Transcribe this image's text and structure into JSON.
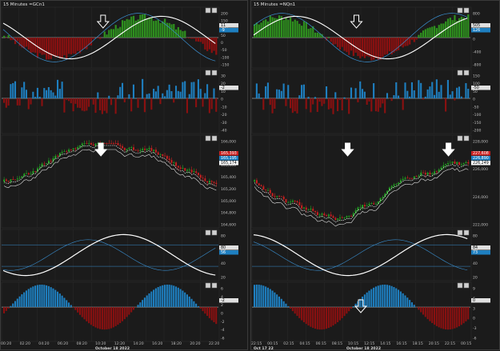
{
  "colors": {
    "bg": "#1b1b1b",
    "grid": "#2e2e2e",
    "green_bar": "#2e8f1e",
    "red_bar": "#8b1010",
    "blue_bar": "#1e7fc0",
    "candle_up": "#22a322",
    "candle_down": "#c92020",
    "white_line": "#ffffff",
    "blue_line": "#3a8fd0",
    "arrow": "#ffffff"
  },
  "charts": [
    {
      "id": "left",
      "title": "15 Minutes =GCn1",
      "panes": [
        {
          "ticks": [
            "200",
            "150",
            "100",
            "50",
            "0",
            "-50",
            "-100",
            "-150"
          ],
          "badges": [
            "11",
            "-9"
          ]
        },
        {
          "ticks": [
            "30",
            "20",
            "10",
            "0",
            "-10",
            "-20",
            "-30",
            "-40"
          ],
          "badges": [
            "-2"
          ]
        },
        {
          "ticks": [
            "166,000",
            "165,800",
            "165,600",
            "165,400",
            "165,200",
            "165,000",
            "164,800",
            "164,600"
          ],
          "badges": [
            "165,393",
            "165,195",
            "165,174"
          ]
        },
        {
          "ticks": [
            "80",
            "60",
            "40",
            "20"
          ],
          "badges": [
            "80",
            "56"
          ]
        },
        {
          "ticks": [
            "6",
            "4",
            "2",
            "0",
            "-2",
            "-4",
            "-6"
          ],
          "badges": [
            "-2"
          ]
        }
      ],
      "xlabels": [
        "00:20",
        "02:20",
        "04:20",
        "06:20",
        "08:20",
        "10:20",
        "12:20",
        "14:20",
        "16:20",
        "18:20",
        "20:20",
        "22:20"
      ],
      "xcenter": "October 18 2022",
      "arrows": [
        {
          "pane": 0,
          "style": "outline"
        },
        {
          "pane": 2,
          "style": "solid"
        }
      ]
    },
    {
      "id": "right",
      "title": "15 Minutes =NQn1",
      "panes": [
        {
          "ticks": [
            "800",
            "400",
            "0",
            "-400",
            "-800"
          ],
          "badges": [
            "505",
            "126"
          ]
        },
        {
          "ticks": [
            "150",
            "100",
            "50",
            "0",
            "-50",
            "-100",
            "-150",
            "-200"
          ],
          "badges": [
            "-50"
          ]
        },
        {
          "ticks": [
            "228,000",
            "226,000",
            "224,000",
            "222,000"
          ],
          "badges": [
            "227,608",
            "226,890",
            "226,249"
          ]
        },
        {
          "ticks": [
            "80",
            "60",
            "40",
            "20"
          ],
          "badges": [
            "84",
            "73"
          ]
        },
        {
          "ticks": [
            "9",
            "6",
            "3",
            "0",
            "-3",
            "-6"
          ],
          "badges": [
            "0"
          ]
        }
      ],
      "xlabels": [
        "22:15",
        "00:15",
        "02:15",
        "04:15",
        "06:15",
        "08:15",
        "10:15",
        "12:15",
        "14:15",
        "16:15",
        "18:15",
        "20:15",
        "22:15",
        "00:15"
      ],
      "xleft": "Oct 17 22",
      "xcenter": "October 18 2022",
      "arrows": [
        {
          "pane": 0,
          "style": "outline"
        },
        {
          "pane": 2,
          "style": "solid"
        },
        {
          "pane": 2,
          "style": "solid"
        },
        {
          "pane": 4,
          "style": "outline"
        }
      ]
    }
  ]
}
